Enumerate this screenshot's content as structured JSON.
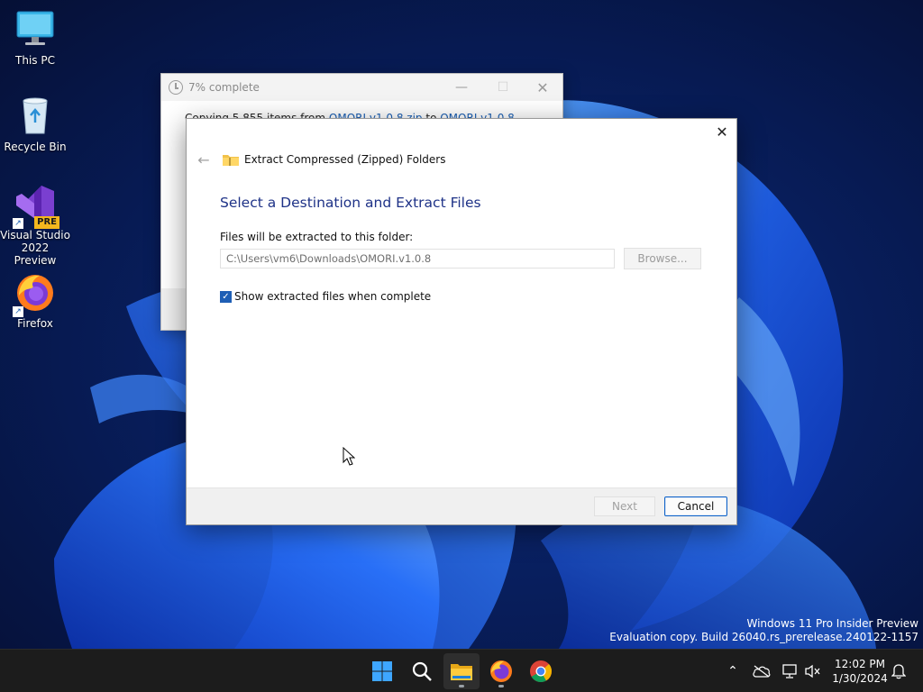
{
  "desktop": {
    "icons": [
      {
        "label": "This PC"
      },
      {
        "label": "Recycle Bin"
      },
      {
        "label": "Visual Studio 2022 Preview",
        "badge": "PRE"
      },
      {
        "label": "Firefox"
      }
    ]
  },
  "progress_window": {
    "title": "7% complete",
    "body_prefix": "Copying 5,855 items from ",
    "source": "OMORI.v1.0.8.zip",
    "connector": " to ",
    "dest": "OMORI.v1.0.8"
  },
  "wizard": {
    "header_title": "Extract Compressed (Zipped) Folders",
    "heading": "Select a Destination and Extract Files",
    "dest_label": "Files will be extracted to this folder:",
    "path_value": "C:\\Users\\vm6\\Downloads\\OMORI.v1.0.8",
    "browse_label": "Browse...",
    "show_files_label": "Show extracted files when complete",
    "show_files_checked": true,
    "next_label": "Next",
    "cancel_label": "Cancel"
  },
  "watermark": {
    "line1": "Windows 11 Pro Insider Preview",
    "line2": "Evaluation copy. Build 26040.rs_prerelease.240122-1157"
  },
  "taskbar": {
    "apps": [
      "start-icon",
      "search-icon",
      "file-explorer-icon",
      "firefox-icon",
      "chrome-icon"
    ],
    "time": "12:02 PM",
    "date": "1/30/2024"
  },
  "colors": {
    "heading": "#1e3287",
    "accent": "#0f63c8",
    "taskbar": "#1c1c1c"
  }
}
